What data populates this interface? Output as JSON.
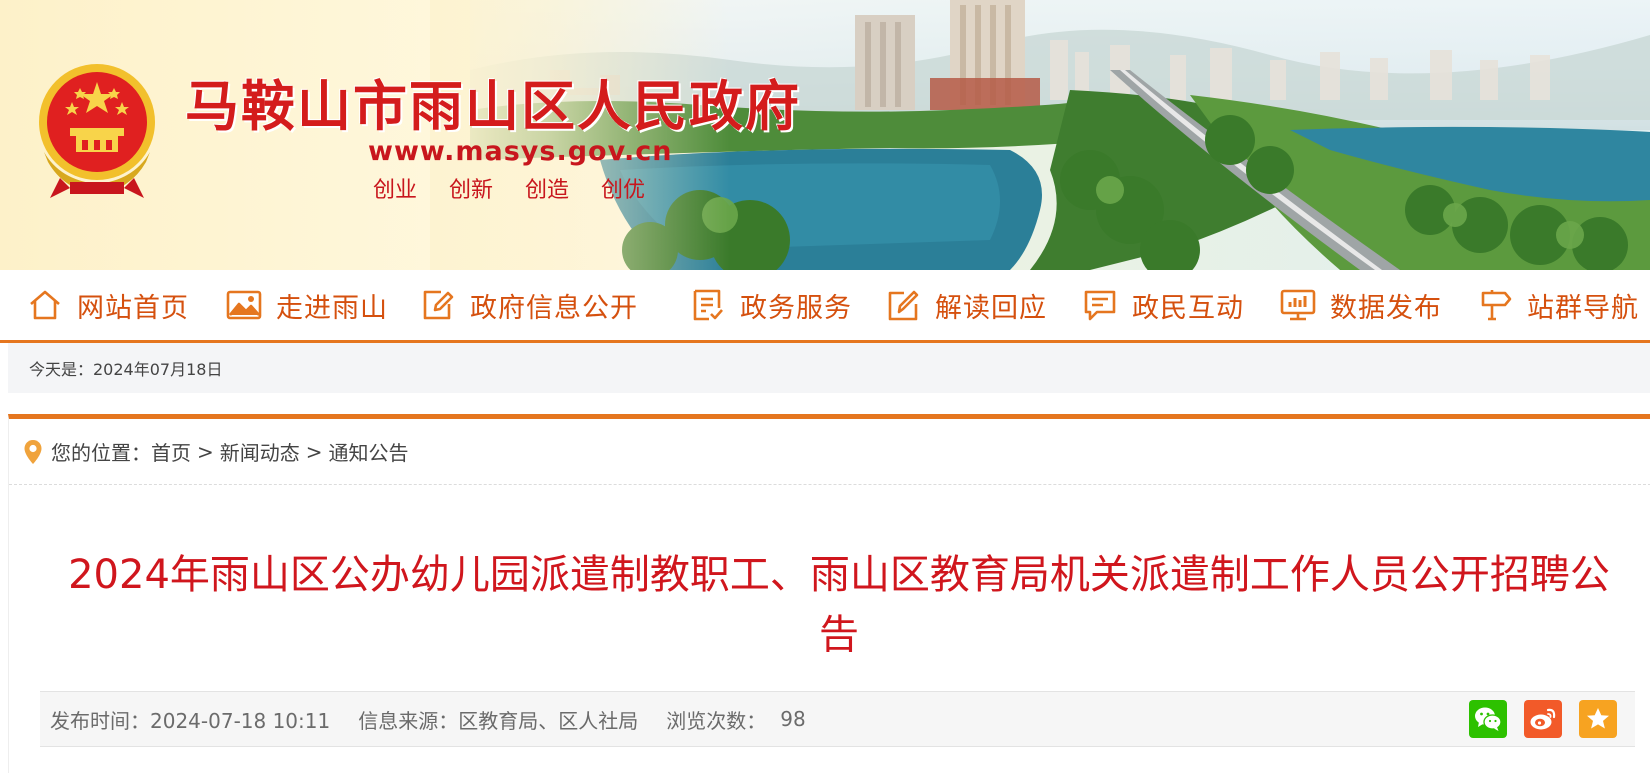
{
  "header": {
    "site_title": "马鞍山市雨山区人民政府",
    "site_url": "www.masys.gov.cn",
    "slogans": [
      "创业",
      "创新",
      "创造",
      "创优"
    ]
  },
  "nav": {
    "items": [
      {
        "label": "网站首页",
        "icon": "home-icon"
      },
      {
        "label": "走进雨山",
        "icon": "picture-icon"
      },
      {
        "label": "政府信息公开",
        "icon": "edit-icon"
      },
      {
        "label": "政务服务",
        "icon": "document-check-icon"
      },
      {
        "label": "解读回应",
        "icon": "edit-square-icon"
      },
      {
        "label": "政民互动",
        "icon": "chat-icon"
      },
      {
        "label": "数据发布",
        "icon": "monitor-chart-icon"
      },
      {
        "label": "站群导航",
        "icon": "signpost-icon"
      }
    ]
  },
  "datebar": {
    "text": "今天是：2024年07月18日"
  },
  "breadcrumb": {
    "prefix": "您的位置：",
    "items": [
      "首页",
      "新闻动态",
      "通知公告"
    ],
    "separator": ">"
  },
  "article": {
    "title": "2024年雨山区公办幼儿园派遣制教职工、雨山区教育局机关派遣制工作人员公开招聘公告",
    "publish_time": "发布时间：2024-07-18 10:11",
    "source": "信息来源：区教育局、区人社局",
    "views_label": "浏览次数：",
    "views_count": "98"
  },
  "share": {
    "buttons": [
      {
        "name": "wechat-share",
        "color": "#2dc100",
        "icon": "wechat-icon"
      },
      {
        "name": "weibo-share",
        "color": "#f25a29",
        "icon": "weibo-icon"
      },
      {
        "name": "favorite",
        "color": "#f7a321",
        "icon": "star-icon"
      }
    ]
  },
  "colors": {
    "accent": "#e5761f",
    "title_red": "#d0161d",
    "nav_text": "#d5500e"
  }
}
